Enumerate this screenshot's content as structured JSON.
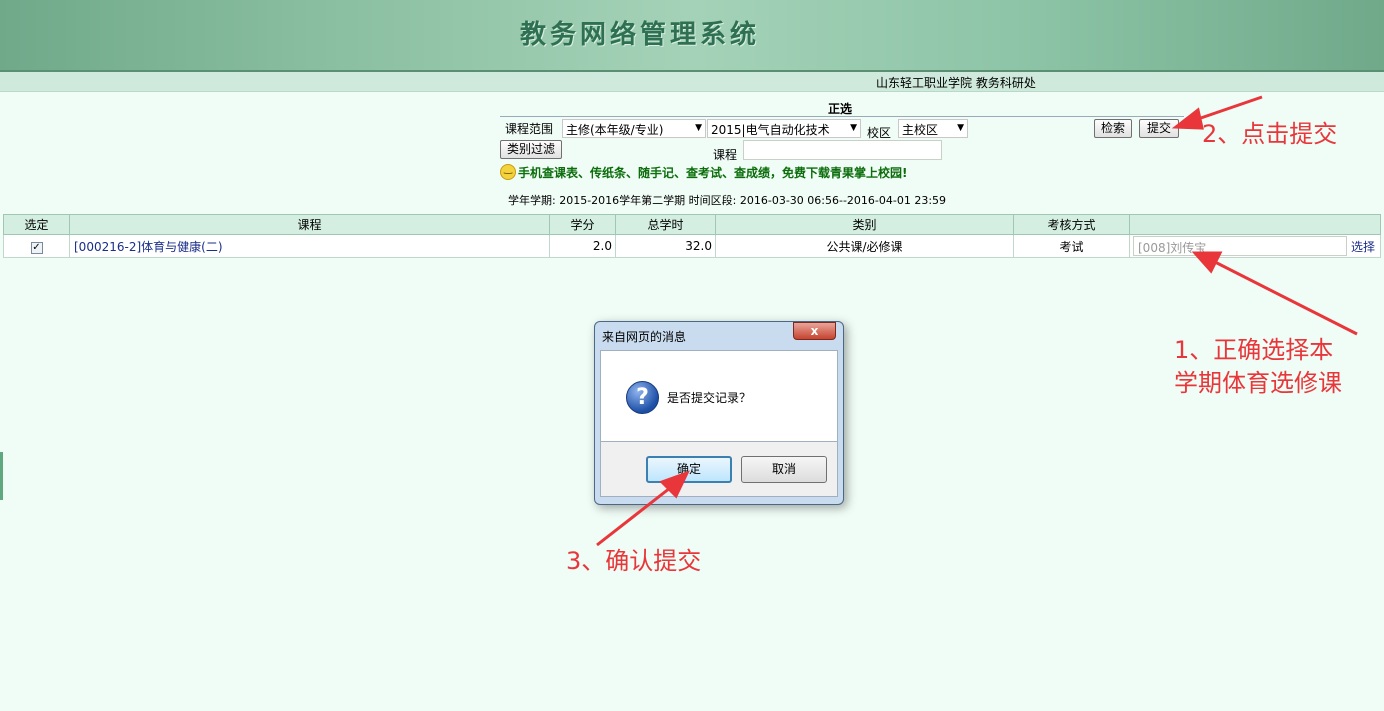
{
  "header": {
    "title": "教务网络管理系统",
    "org": "山东轻工职业学院 教务科研处"
  },
  "page": {
    "section_title": "正选",
    "filters": {
      "course_range_label": "课程范围",
      "course_range_value": "主修(本年级/专业)",
      "major_value": "2015|电气自动化技术",
      "campus_label": "校区",
      "campus_value": "主校区",
      "course_label": "课程",
      "course_value": ""
    },
    "buttons": {
      "search": "检索",
      "submit": "提交",
      "category_filter": "类别过滤"
    },
    "promo_text": "手机查课表、传纸条、随手记、查考试、查成绩，免费下载青果掌上校园!",
    "term_info": "学年学期: 2015-2016学年第二学期  时间区段: 2016-03-30 06:56--2016-04-01 23:59"
  },
  "table": {
    "headers": [
      "选定",
      "课程",
      "学分",
      "总学时",
      "类别",
      "考核方式",
      ""
    ],
    "rows": [
      {
        "checked": "✓",
        "course": "[000216-2]体育与健康(二)",
        "credits": "2.0",
        "hours": "32.0",
        "category": "公共课/必修课",
        "exam": "考试",
        "teacher": "[008]刘传宝",
        "choose": "选择"
      }
    ]
  },
  "dialog": {
    "title": "来自网页的消息",
    "close": "x",
    "icon": "?",
    "message": "是否提交记录？",
    "ok": "确定",
    "cancel": "取消"
  },
  "annotations": {
    "step1_line1": "1、正确选择本",
    "step1_line2": "学期体育选修课",
    "step2": "2、点击提交",
    "step3": "3、确认提交"
  },
  "colors": {
    "annotation": "#e8363a",
    "banner": "#8cc0a2",
    "background": "#f0fcf6"
  }
}
